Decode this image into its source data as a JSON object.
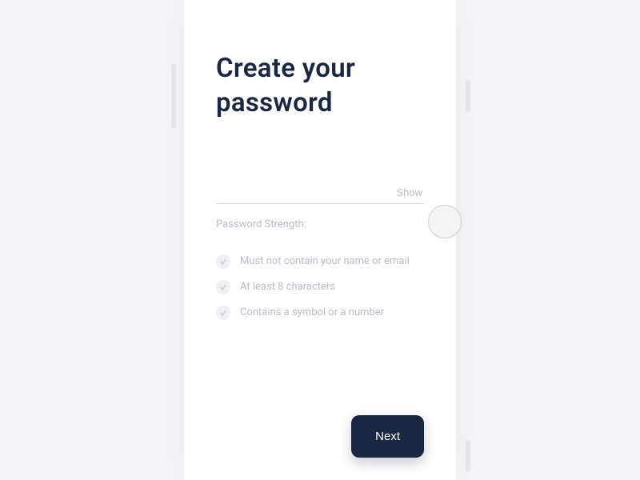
{
  "title": "Create your password",
  "input": {
    "value": "",
    "showLabel": "Show"
  },
  "strengthLabel": "Password Strength:",
  "requirements": [
    "Must not contain your name or email",
    "At least 8 characters",
    "Contains a symbol or a number"
  ],
  "nextLabel": "Next"
}
